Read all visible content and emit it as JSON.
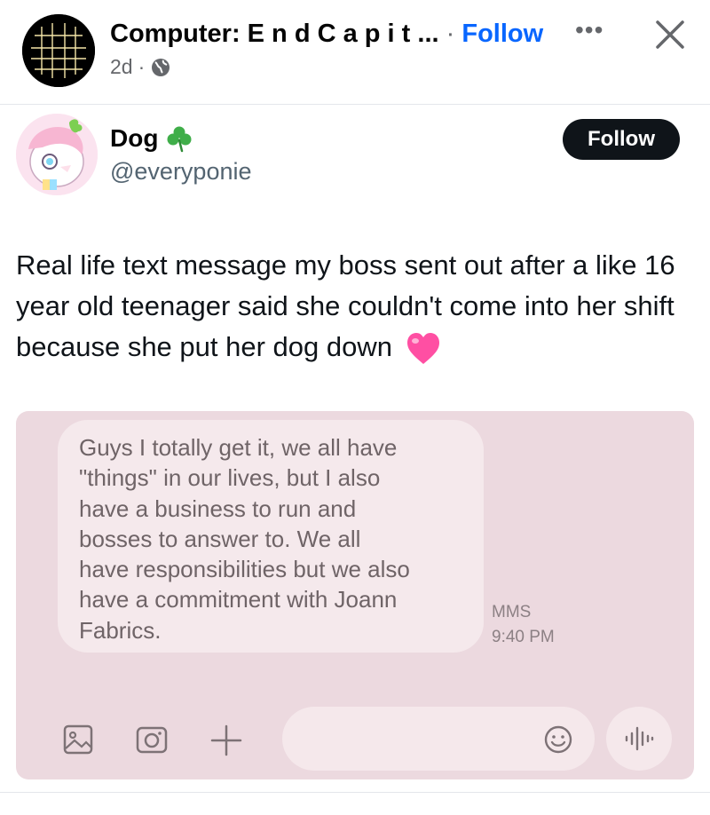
{
  "header": {
    "page_name": "Computer: E n d C a p i t ...",
    "separator": "·",
    "follow_label": "Follow",
    "time": "2d",
    "time_separator": "·",
    "privacy_icon": "globe-icon",
    "more_icon": "more-icon",
    "more_text": "•••",
    "close_icon": "close-icon"
  },
  "tweet": {
    "display_name": "Dog",
    "name_emoji": "☘️",
    "handle": "@everyponie",
    "follow_label": "Follow",
    "text": "Real life text message my boss sent out after a like 16 year old teenager said she couldn't come into her shift because she put her dog down",
    "text_emoji": "pink-heart"
  },
  "sms_screenshot": {
    "message": "Guys I totally get it, we all have\n\"things\" in our lives, but I also\nhave a business to run and\nbosses to answer to. We all\nhave responsibilities but we also\nhave a commitment with Joann\nFabrics.",
    "type_label": "MMS",
    "time": "9:40 PM",
    "icons": [
      "gallery-icon",
      "camera-icon",
      "plus-icon",
      "emoji-icon",
      "voice-icon"
    ]
  },
  "colors": {
    "facebook_blue": "#0866ff",
    "sms_background": "#ecd9df",
    "bubble_background": "#f5e9ec",
    "heart_pink": "#ff4fa3"
  }
}
